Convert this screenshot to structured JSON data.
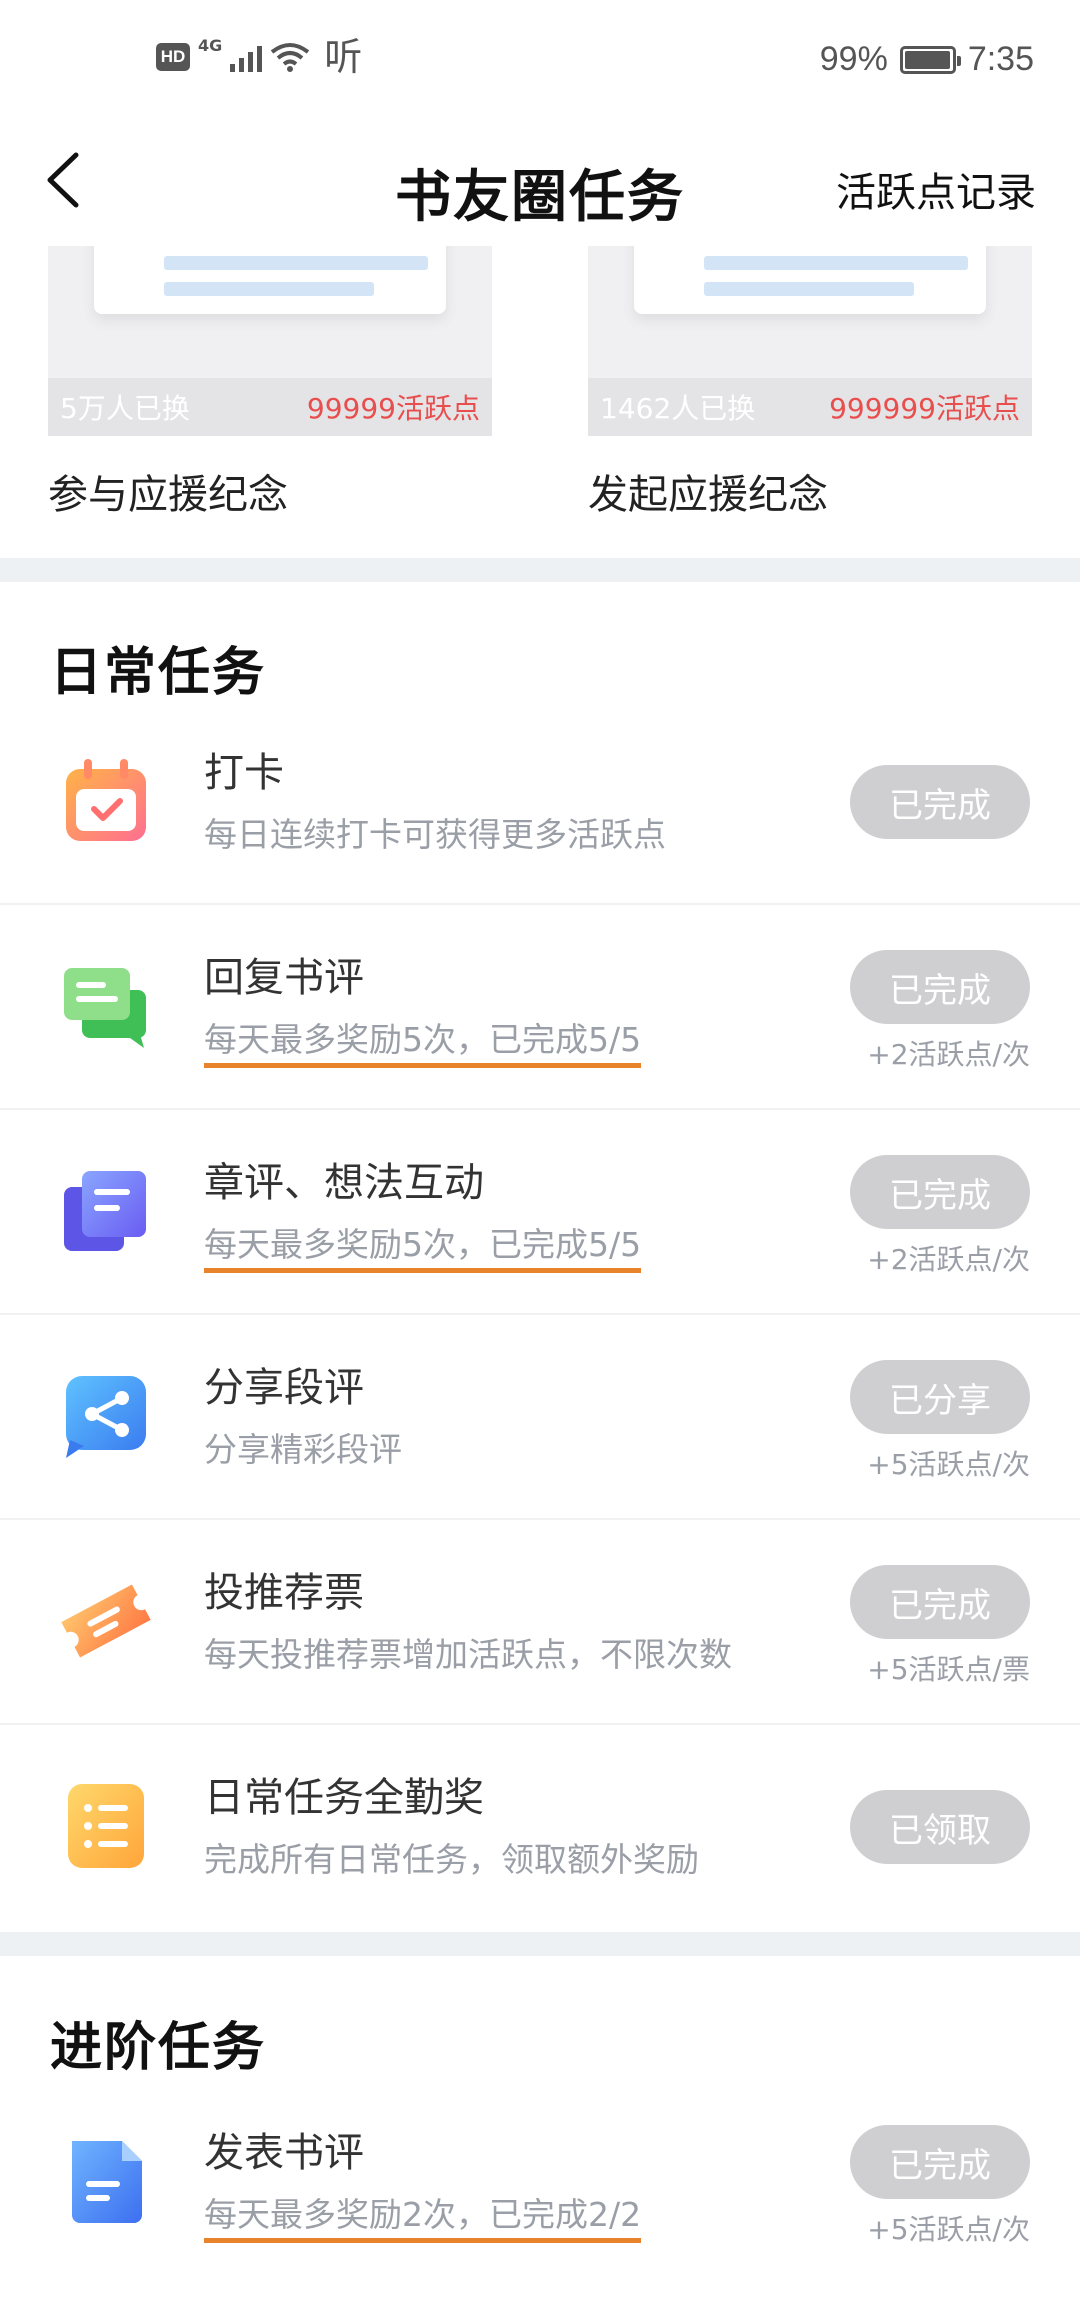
{
  "status_bar": {
    "hd": "HD",
    "network": "4G",
    "listen": "听",
    "battery_percent": "99%",
    "battery_level": 0.99,
    "time": "7:35"
  },
  "nav": {
    "title": "书友圈任务",
    "right_link": "活跃点记录"
  },
  "rewards": [
    {
      "exchanged": "5万人已换",
      "points": "99999活跃点",
      "name": "参与应援纪念"
    },
    {
      "exchanged": "1462人已换",
      "points": "999999活跃点",
      "name": "发起应援纪念"
    }
  ],
  "daily": {
    "title": "日常任务",
    "tasks": [
      {
        "icon": "calendar-check-icon",
        "title": "打卡",
        "desc": "每日连续打卡可获得更多活跃点",
        "button": "已完成",
        "reward": ""
      },
      {
        "icon": "chat-bubbles-icon",
        "title": "回复书评",
        "desc": "每天最多奖励5次，已完成5/5",
        "button": "已完成",
        "reward": "+2活跃点/次"
      },
      {
        "icon": "note-stack-icon",
        "title": "章评、想法互动",
        "desc": "每天最多奖励5次，已完成5/5",
        "button": "已完成",
        "reward": "+2活跃点/次"
      },
      {
        "icon": "share-icon",
        "title": "分享段评",
        "desc": "分享精彩段评",
        "button": "已分享",
        "reward": "+5活跃点/次"
      },
      {
        "icon": "ticket-icon",
        "title": "投推荐票",
        "desc": "每天投推荐票增加活跃点，不限次数",
        "button": "已完成",
        "reward": "+5活跃点/票"
      },
      {
        "icon": "list-icon",
        "title": "日常任务全勤奖",
        "desc": "完成所有日常任务，领取额外奖励",
        "button": "已领取",
        "reward": ""
      }
    ]
  },
  "advanced": {
    "title": "进阶任务",
    "tasks": [
      {
        "icon": "document-icon",
        "title": "发表书评",
        "desc": "每天最多奖励2次，已完成2/2",
        "button": "已完成",
        "reward": "+5活跃点/次"
      }
    ]
  },
  "colors": {
    "accent_underline": "#e8822b",
    "points_red": "#e84e4e",
    "button_gray": "#cfcfd1",
    "section_gap": "#eef1f4"
  }
}
